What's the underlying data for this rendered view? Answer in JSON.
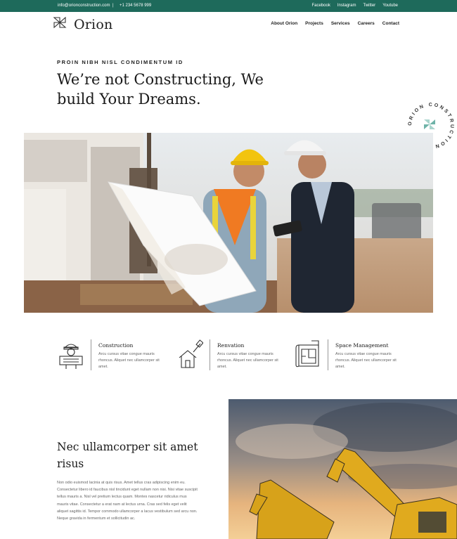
{
  "topbar": {
    "email": "info@orionconstruction.com",
    "separator": "|",
    "phone": "+1 234 5678 999",
    "social": [
      "Facebook",
      "Instagram",
      "Twitter",
      "Youtube"
    ]
  },
  "header": {
    "logo_text": "Orion",
    "nav": [
      "About Orion",
      "Projects",
      "Services",
      "Careers",
      "Contact"
    ]
  },
  "hero": {
    "eyebrow": "PROIN NIBH NISL CONDIMENTUM ID",
    "title_line1": "We’re not Constructing, We",
    "title_line2": "build Your Dreams.",
    "badge_text": "ORION CONSTRUCTION •"
  },
  "services": [
    {
      "title": "Construction",
      "text": "Arcu cursus vitae congue mauris rhoncus. Aliquet nec ullamcorper sit amet.",
      "icon": "construction-worker-icon"
    },
    {
      "title": "Renvation",
      "text": "Arcu cursus vitae congue mauris rhoncus. Aliquet nec ullamcorper sit amet.",
      "icon": "house-brush-icon"
    },
    {
      "title": "Space Management",
      "text": "Arcu cursus vitae congue mauris rhoncus. Aliquet nec ullamcorper sit amet.",
      "icon": "blueprint-plan-icon"
    }
  ],
  "about": {
    "title_line1": "Nec ullamcorper sit amet",
    "title_line2": "risus",
    "text": "Non odio euismod lacinia at quis risus. Amet tellus cras adipiscing enim eu. Consectetur libero id faucibus nisl tincidunt eget nullam non nisi. Nisi vitae suscipit tellus mauris a. Nisl vel pretium lectus quam. Montes nascetur ridiculus mus mauris vitae. Consectetur a erat nam at lectus urna. Cras sed felis eget velit aliquet sagittis id. Tempor commodo ullamcorper a lacus vestibulum sed arcu non. Neque gravida in fermentum et sollicitudin ac."
  },
  "colors": {
    "brand_green": "#1e6a5b",
    "accent_teal": "#6fb3a8"
  }
}
